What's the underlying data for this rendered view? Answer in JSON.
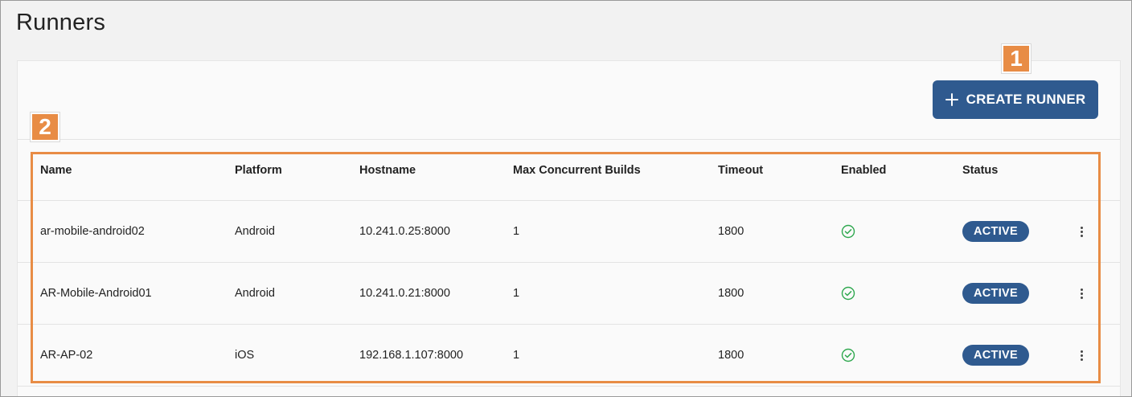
{
  "page": {
    "title": "Runners"
  },
  "toolbar": {
    "create_label": "CREATE RUNNER"
  },
  "callouts": {
    "one": "1",
    "two": "2"
  },
  "colors": {
    "accent": "#2f5a8f",
    "callout": "#e88c45",
    "enabled_check": "#2fa84f"
  },
  "table": {
    "headers": {
      "name": "Name",
      "platform": "Platform",
      "hostname": "Hostname",
      "max": "Max Concurrent Builds",
      "timeout": "Timeout",
      "enabled": "Enabled",
      "status": "Status"
    },
    "rows": [
      {
        "name": "ar-mobile-android02",
        "platform": "Android",
        "hostname": "10.241.0.25:8000",
        "max": "1",
        "timeout": "1800",
        "enabled_icon": "check-circle-icon",
        "status": "ACTIVE"
      },
      {
        "name": "AR-Mobile-Android01",
        "platform": "Android",
        "hostname": "10.241.0.21:8000",
        "max": "1",
        "timeout": "1800",
        "enabled_icon": "check-circle-icon",
        "status": "ACTIVE"
      },
      {
        "name": "AR-AP-02",
        "platform": "iOS",
        "hostname": "192.168.1.107:8000",
        "max": "1",
        "timeout": "1800",
        "enabled_icon": "check-circle-icon",
        "status": "ACTIVE"
      }
    ]
  }
}
